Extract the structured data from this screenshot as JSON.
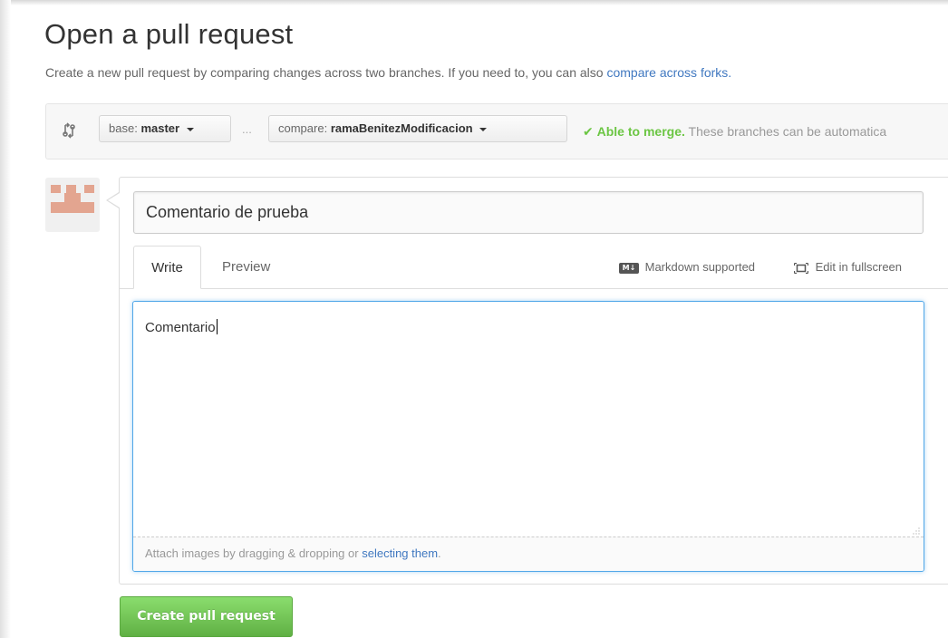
{
  "page": {
    "title": "Open a pull request",
    "subtitle_text": "Create a new pull request by comparing changes across two branches. If you need to, you can also",
    "subtitle_link": "compare across forks."
  },
  "range": {
    "base_prefix": "base:",
    "base_branch": "master",
    "separator": "...",
    "compare_prefix": "compare:",
    "compare_branch": "ramaBenitezModificacion",
    "merge_ok": "Able to merge.",
    "merge_detail": "These branches can be automatica"
  },
  "form": {
    "title_value": "Comentario de prueba",
    "tabs": [
      {
        "label": "Write"
      },
      {
        "label": "Preview"
      }
    ],
    "markdown_label": "Markdown supported",
    "markdown_badge": "M↓",
    "fullscreen_label": "Edit in fullscreen",
    "body_value": "Comentario",
    "attach_text": "Attach images by dragging & dropping or",
    "attach_link": "selecting them",
    "attach_end": "."
  },
  "actions": {
    "submit_label": "Create pull request"
  },
  "colors": {
    "link": "#4078c0",
    "success": "#6cc644",
    "focus": "#51a7e8",
    "button_green": "#60b044"
  },
  "icons": {
    "compare": "git-compare-icon",
    "check": "check-icon",
    "markdown": "markdown-icon",
    "fullscreen": "fullscreen-icon"
  }
}
